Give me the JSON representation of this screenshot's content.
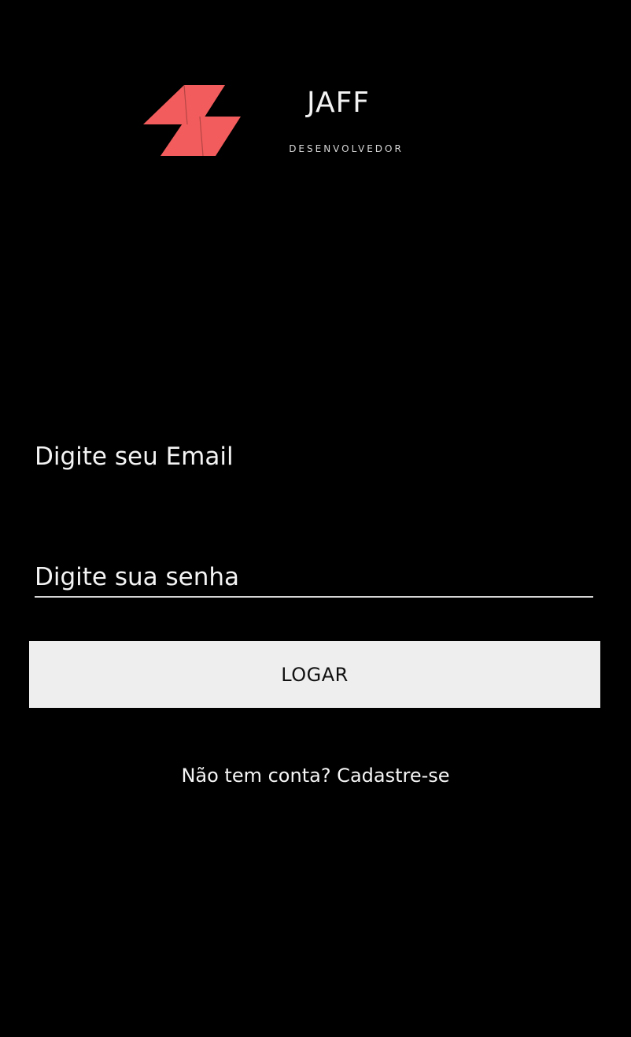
{
  "brand": {
    "name": "JAFF",
    "tagline": "DESENVOLVEDOR",
    "logo_icon": "double-parallelogram-logo",
    "accent_color": "#f25c5c"
  },
  "login_form": {
    "email_placeholder": "Digite seu Email",
    "email_value": "",
    "password_placeholder": "Digite sua senha",
    "password_value": "",
    "login_button_label": "LOGAR",
    "signup_link_text": "Não tem conta? Cadastre-se"
  }
}
